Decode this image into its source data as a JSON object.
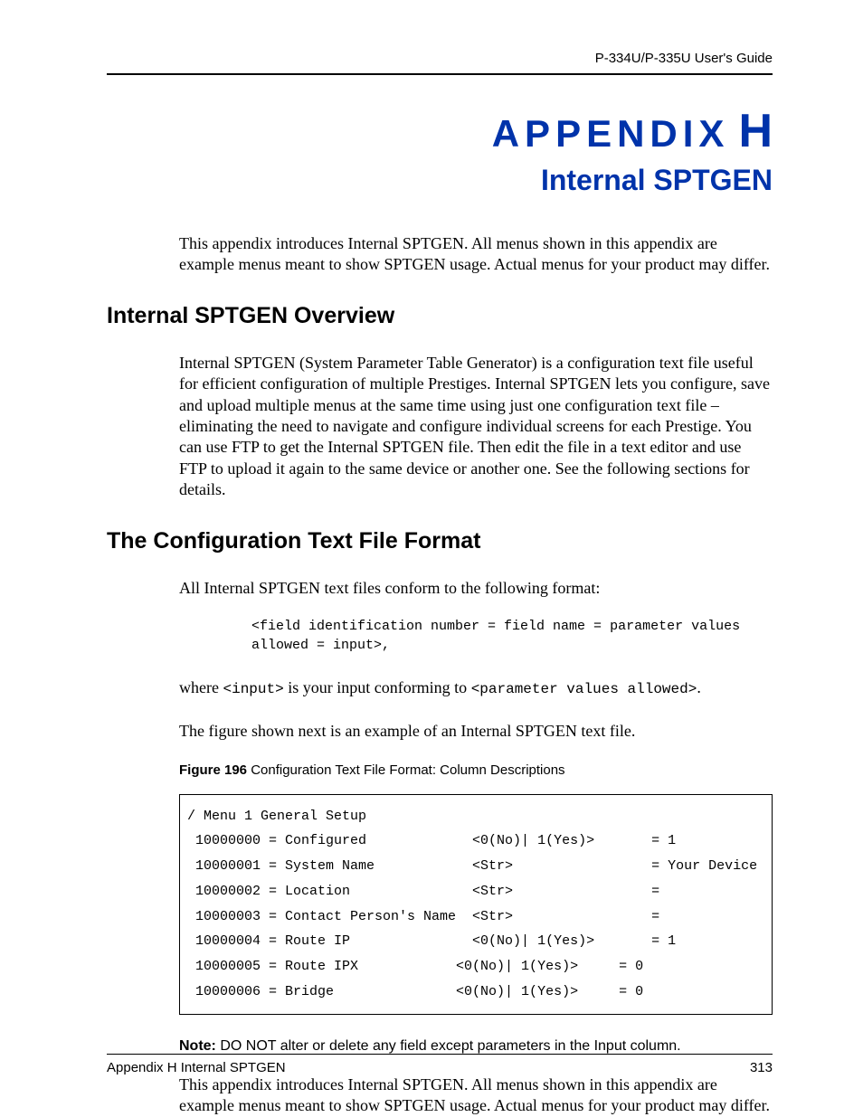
{
  "header": {
    "guide": "P-334U/P-335U User's Guide"
  },
  "title": {
    "appendix_word": "APPENDIX",
    "appendix_letter": "H",
    "subtitle": "Internal SPTGEN"
  },
  "intro_para": "This appendix introduces Internal SPTGEN. All menus shown in this appendix are example menus meant to show SPTGEN usage. Actual menus for your product may differ.",
  "section1": {
    "heading": "Internal SPTGEN Overview",
    "para": "Internal SPTGEN (System Parameter Table Generator) is a configuration text file useful for efficient configuration of multiple Prestiges. Internal SPTGEN lets you configure, save and upload multiple menus at the same time using just one configuration text file – eliminating the need to navigate and configure individual screens for each Prestige. You can use FTP to get the Internal SPTGEN file. Then edit the file in a text editor and use FTP to upload it again to the same device or another one. See the following sections for details."
  },
  "section2": {
    "heading": "The Configuration Text File Format",
    "para1": "All Internal SPTGEN text files conform to the following format:",
    "format_block": "<field identification number = field name = parameter values\nallowed = input>,",
    "para2_pre": "where ",
    "para2_code1": "<input>",
    "para2_mid": " is your input conforming to ",
    "para2_code2": "<parameter values allowed>",
    "para2_post": ".",
    "para3": "The figure shown next is an example of an Internal SPTGEN text file.",
    "figure_label": "Figure 196",
    "figure_caption": "   Configuration Text File Format: Column Descriptions",
    "code_box": "/ Menu 1 General Setup\n 10000000 = Configured             <0(No)| 1(Yes)>       = 1\n 10000001 = System Name            <Str>                 = Your Device\n 10000002 = Location               <Str>                 =\n 10000003 = Contact Person's Name  <Str>                 =\n 10000004 = Route IP               <0(No)| 1(Yes)>       = 1\n 10000005 = Route IPX            <0(No)| 1(Yes)>     = 0\n 10000006 = Bridge               <0(No)| 1(Yes)>     = 0",
    "note_label": "Note:",
    "note_text": " DO NOT alter or delete any field except parameters in the Input column.",
    "para4": "This appendix introduces Internal SPTGEN. All menus shown in this appendix are example menus meant to show SPTGEN usage. Actual menus for your product may differ."
  },
  "footer": {
    "left": "Appendix H Internal SPTGEN",
    "right": "313"
  }
}
